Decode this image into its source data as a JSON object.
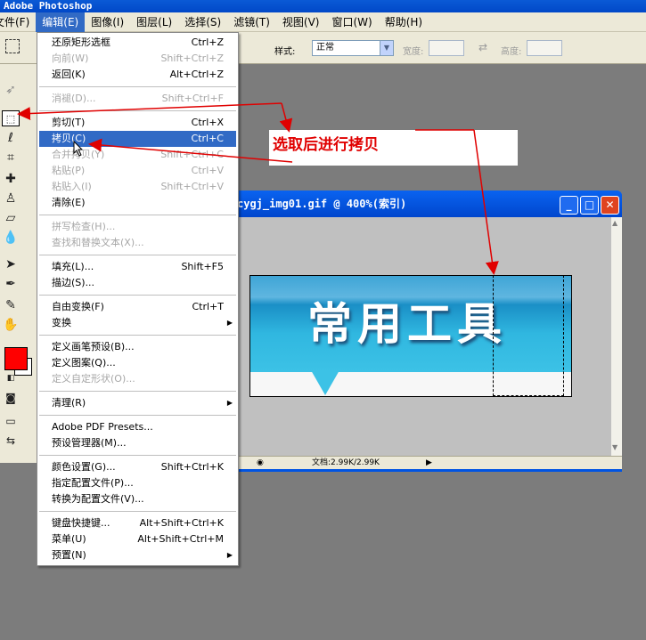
{
  "app": {
    "title": "Adobe Photoshop"
  },
  "menubar": {
    "items": [
      {
        "label": "文件(F)"
      },
      {
        "label": "编辑(E)"
      },
      {
        "label": "图像(I)"
      },
      {
        "label": "图层(L)"
      },
      {
        "label": "选择(S)"
      },
      {
        "label": "滤镜(T)"
      },
      {
        "label": "视图(V)"
      },
      {
        "label": "窗口(W)"
      },
      {
        "label": "帮助(H)"
      }
    ]
  },
  "options": {
    "style_label": "样式:",
    "style_value": "正常",
    "width_label": "宽度:",
    "height_label": "高度:"
  },
  "edit_menu": {
    "items": [
      {
        "label": "还原矩形选框",
        "shortcut": "Ctrl+Z"
      },
      {
        "label": "向前(W)",
        "shortcut": "Shift+Ctrl+Z"
      },
      {
        "label": "返回(K)",
        "shortcut": "Alt+Ctrl+Z"
      },
      {
        "label": "消褪(D)...",
        "shortcut": "Shift+Ctrl+F"
      },
      {
        "label": "剪切(T)",
        "shortcut": "Ctrl+X"
      },
      {
        "label": "拷贝(C)",
        "shortcut": "Ctrl+C"
      },
      {
        "label": "合并拷贝(Y)",
        "shortcut": "Shift+Ctrl+C"
      },
      {
        "label": "粘贴(P)",
        "shortcut": "Ctrl+V"
      },
      {
        "label": "粘贴入(I)",
        "shortcut": "Shift+Ctrl+V"
      },
      {
        "label": "清除(E)",
        "shortcut": ""
      },
      {
        "label": "拼写检查(H)...",
        "shortcut": ""
      },
      {
        "label": "查找和替换文本(X)...",
        "shortcut": ""
      },
      {
        "label": "填充(L)...",
        "shortcut": "Shift+F5"
      },
      {
        "label": "描边(S)...",
        "shortcut": ""
      },
      {
        "label": "自由变换(F)",
        "shortcut": "Ctrl+T"
      },
      {
        "label": "变换",
        "shortcut": ""
      },
      {
        "label": "定义画笔预设(B)...",
        "shortcut": ""
      },
      {
        "label": "定义图案(Q)...",
        "shortcut": ""
      },
      {
        "label": "定义自定形状(O)...",
        "shortcut": ""
      },
      {
        "label": "清理(R)",
        "shortcut": ""
      },
      {
        "label": "Adobe PDF Presets...",
        "shortcut": ""
      },
      {
        "label": "预设管理器(M)...",
        "shortcut": ""
      },
      {
        "label": "颜色设置(G)...",
        "shortcut": "Shift+Ctrl+K"
      },
      {
        "label": "指定配置文件(P)...",
        "shortcut": ""
      },
      {
        "label": "转换为配置文件(V)...",
        "shortcut": ""
      },
      {
        "label": "键盘快捷键...",
        "shortcut": "Alt+Shift+Ctrl+K"
      },
      {
        "label": "菜单(U)",
        "shortcut": "Alt+Shift+Ctrl+M"
      },
      {
        "label": "预置(N)",
        "shortcut": ""
      }
    ]
  },
  "document": {
    "title": "cygj_img01.gif @ 400%(索引)",
    "banner_text": "常用工具",
    "status": "文档:2.99K/2.99K"
  },
  "annotation": {
    "text": "选取后进行拷贝"
  },
  "colors": {
    "foreground": "#ff0000",
    "background": "#ffffff",
    "accent": "#316ac5",
    "annotation": "#e00000"
  }
}
